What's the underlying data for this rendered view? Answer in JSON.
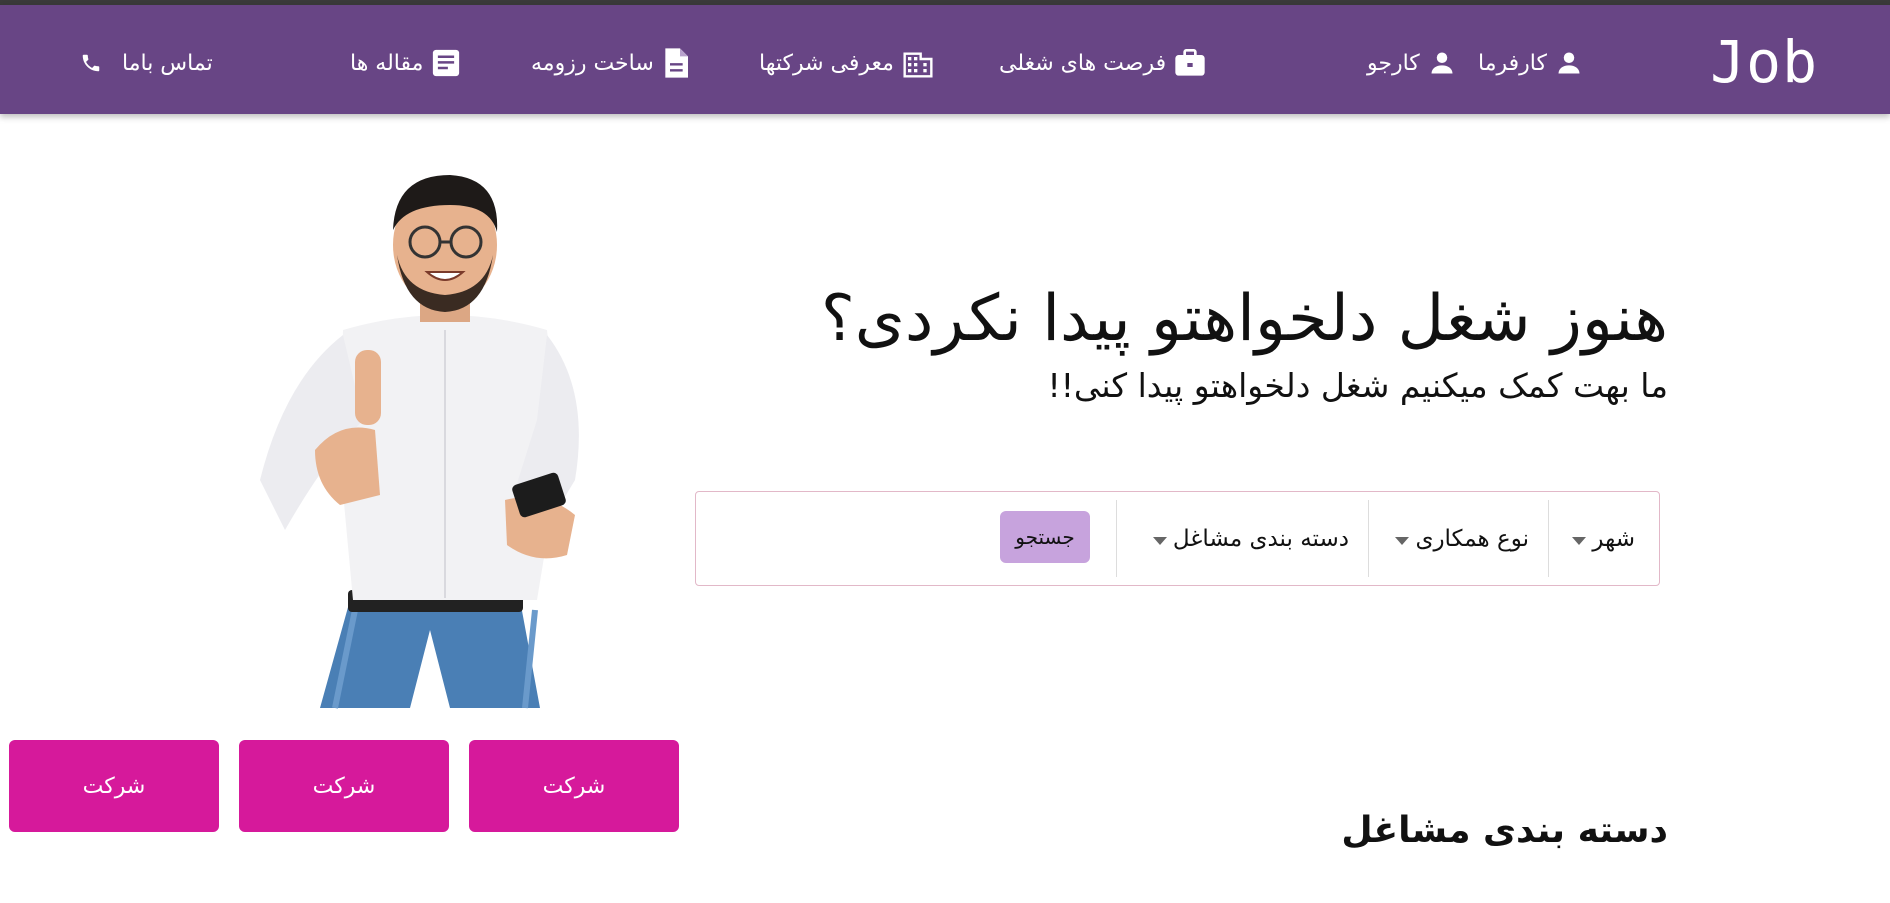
{
  "brand": {
    "logo": "Job"
  },
  "nav": {
    "employer": "کارفرما",
    "jobseeker": "کارجو",
    "job_opportunities": "فرصت های شغلی",
    "companies": "معرفی شرکتها",
    "resume": "ساخت رزومه",
    "articles": "مقاله ها",
    "contact": "تماس باما"
  },
  "hero": {
    "headline": "هنوز شغل دلخواهتو پیدا نکردی؟",
    "subline": "ما بهت کمک میکنیم شغل دلخواهتو پیدا کنی!!"
  },
  "search": {
    "filters": [
      "شهر",
      "نوع همکاری",
      "دسته بندی مشاغل"
    ],
    "button": "جستجو"
  },
  "companies": {
    "buttons": [
      "شرکت",
      "شرکت",
      "شرکت"
    ]
  },
  "categories": {
    "title": "دسته بندی مشاغل"
  },
  "colors": {
    "navbar": "#684585",
    "company_button": "#d6199b",
    "search_button": "#c7a3dd"
  },
  "icons": [
    "person-icon",
    "briefcase-icon",
    "building-icon",
    "document-icon",
    "article-icon",
    "phone-icon",
    "caret-down-icon"
  ]
}
